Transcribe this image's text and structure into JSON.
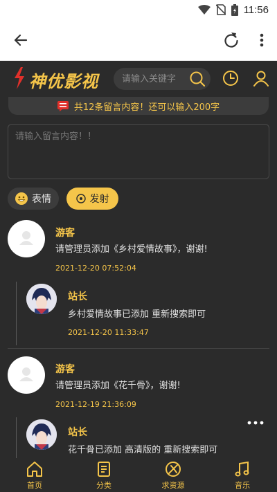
{
  "status_bar": {
    "time": "11:56",
    "icons": [
      "wifi-icon",
      "no-sim-icon",
      "battery-icon"
    ]
  },
  "top_bar": {
    "icons": [
      "back-arrow-icon",
      "reload-icon",
      "more-vertical-icon"
    ]
  },
  "header": {
    "logo_text": "神优影视",
    "search_placeholder": "请输入关键字",
    "icons": [
      "search-icon",
      "history-clock-icon",
      "user-icon"
    ]
  },
  "notice": {
    "text": "共12条留言内容！还可以输入200字"
  },
  "message_box": {
    "placeholder": "请输入留言内容！！"
  },
  "actions": {
    "emoji_label": "表情",
    "send_label": "发射"
  },
  "comments": [
    {
      "author": "游客",
      "text": "请管理员添加《乡村爱情故事》，谢谢!",
      "time": "2021-12-20 07:52:04",
      "reply": {
        "author": "站长",
        "text": "乡村爱情故事已添加 重新搜索即可",
        "time": "2021-12-20 11:33:47"
      }
    },
    {
      "author": "游客",
      "text": "请管理员添加《花千骨》，谢谢!",
      "time": "2021-12-19 21:36:09",
      "reply": {
        "author": "站长",
        "text": "花千骨已添加 高清版的 重新搜索即可",
        "time": ""
      }
    }
  ],
  "bottom_nav": [
    {
      "label": "首页",
      "icon": "home-icon"
    },
    {
      "label": "分类",
      "icon": "category-icon"
    },
    {
      "label": "求资源",
      "icon": "request-resource-icon"
    },
    {
      "label": "音乐",
      "icon": "music-icon"
    }
  ],
  "colors": {
    "accent": "#f5c54a",
    "background": "#2b2b2b",
    "panel": "#3c3c3c",
    "logo_red": "#e0302a"
  }
}
